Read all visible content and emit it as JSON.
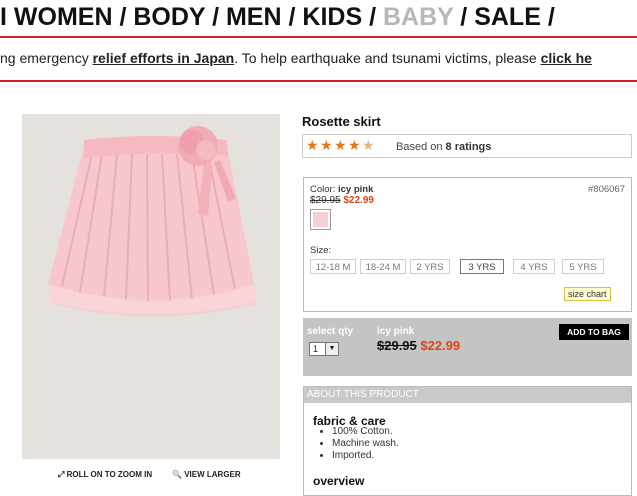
{
  "nav": {
    "items": [
      "WOMEN",
      "BODY",
      "MEN",
      "KIDS",
      "BABY",
      "SALE"
    ],
    "separator": " / ",
    "partial_start": "I",
    "partial_end": "/"
  },
  "banner": {
    "prefix": "ng emergency ",
    "link1": "relief efforts in Japan",
    "middle": ". To help earthquake and tsunami victims, please ",
    "link2": "click he"
  },
  "image_tools": {
    "zoom_label": "ROLL ON TO ZOOM IN",
    "view_label": "VIEW LARGER"
  },
  "product": {
    "title": "Rosette skirt",
    "rating": {
      "stars": 4.5,
      "based_on": "Based on",
      "count": "8 ratings"
    },
    "color_label": "Color:",
    "color_name": "icy pink",
    "sku": "#806067",
    "price_old": "$29.95",
    "price_new": "$22.99",
    "swatch_color": "#f4cfd3",
    "size_label": "Size:",
    "sizes": [
      "12-18 M",
      "18-24 M",
      "2 YRS",
      "3 YRS",
      "4 YRS",
      "5 YRS"
    ],
    "selected_size": "3 YRS",
    "size_chart": "size chart"
  },
  "buy": {
    "qty_label": "select qty",
    "qty_value": "1",
    "color_name": "icy pink",
    "price_old": "$29.95",
    "price_new": "$22.99",
    "add_label": "ADD TO BAG"
  },
  "about": {
    "heading": "ABOUT THIS PRODUCT",
    "section1": "fabric & care",
    "bullets": [
      "100% Cotton.",
      "Machine wash.",
      "Imported."
    ],
    "section2": "overview"
  },
  "colors": {
    "accent": "#d01f2c",
    "sale": "#d6461a",
    "star": "#e07a16"
  }
}
